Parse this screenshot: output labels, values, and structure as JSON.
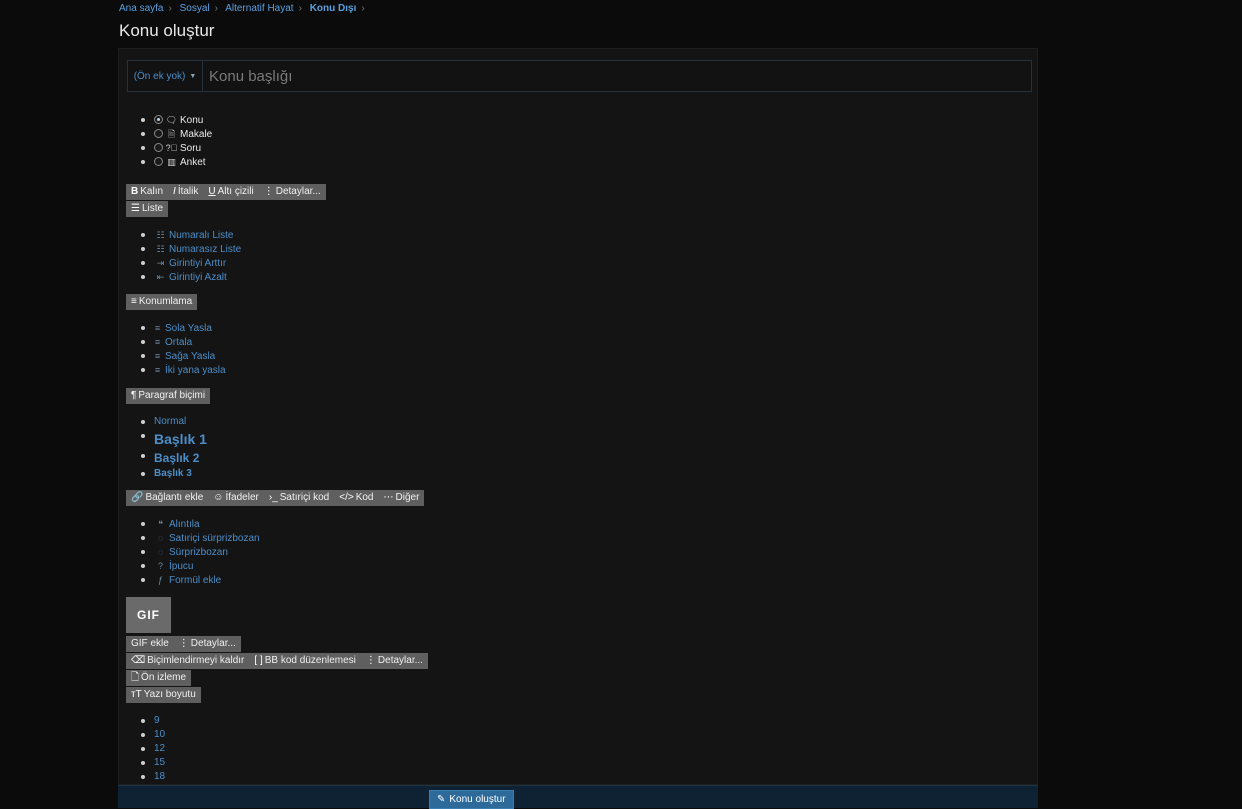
{
  "breadcrumb": [
    {
      "label": "Ana sayfa"
    },
    {
      "label": "Sosyal"
    },
    {
      "label": "Alternatif Hayat"
    },
    {
      "label": "Konu Dışı"
    }
  ],
  "page_title": "Konu oluştur",
  "prefix": {
    "label": "(Ön ek yok)"
  },
  "title_input": {
    "placeholder": "Konu başlığı",
    "value": ""
  },
  "thread_types": [
    {
      "label": "Konu",
      "checked": true,
      "icon": "comments-icon"
    },
    {
      "label": "Makale",
      "checked": false,
      "icon": "document-icon"
    },
    {
      "label": "Soru",
      "checked": false,
      "icon": "question-circle-icon"
    },
    {
      "label": "Anket",
      "checked": false,
      "icon": "chart-bar-icon"
    }
  ],
  "toolbar1": {
    "bold": "Kalın",
    "italic": "İtalik",
    "underline": "Altı çizili",
    "more": "Detaylar..."
  },
  "list_btn": "Liste",
  "list_menu": [
    "Numaralı Liste",
    "Numarasız Liste",
    "Girintiyi Arttır",
    "Girintiyi Azalt"
  ],
  "align_btn": "Konumlama",
  "align_menu": [
    "Sola Yasla",
    "Ortala",
    "Sağa Yasla",
    "İki yana yasla"
  ],
  "paragraph_btn": "Paragraf biçimi",
  "paragraph_menu": [
    "Normal",
    "Başlık 1",
    "Başlık 2",
    "Başlık 3"
  ],
  "toolbar2": {
    "link": "Bağlantı ekle",
    "smilies": "İfadeler",
    "inline_code": "Satıriçi kod",
    "code": "Kod",
    "more": "Diğer"
  },
  "insert_menu": [
    "Alıntıla",
    "Satıriçi sürprizbozan",
    "Sürprizbozan",
    "İpucu",
    "Formül ekle"
  ],
  "gif": {
    "icon_text": "GIF",
    "add": "GIF ekle",
    "more": "Detaylar..."
  },
  "toolbar3": {
    "remove_format": "Biçimlendirmeyi kaldır",
    "bbcode": "BB kod düzenlemesi",
    "more": "Detaylar..."
  },
  "preview": "Ön izleme",
  "font_size_btn": "Yazı boyutu",
  "font_sizes": [
    "9",
    "10",
    "12",
    "15",
    "18"
  ],
  "submit": "Konu oluştur",
  "colors": {
    "accent": "#4c8ec8",
    "button": "#2d6a9a",
    "toolbar": "#5f5f5f",
    "background": "#0b0b0b"
  }
}
